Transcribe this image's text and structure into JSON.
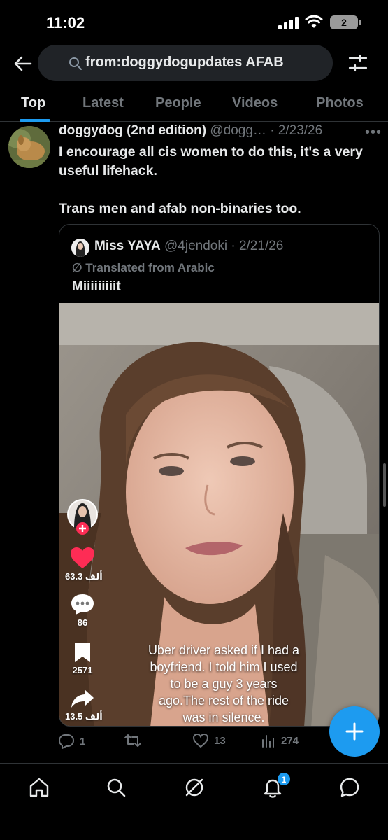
{
  "status_bar": {
    "time": "11:02",
    "battery": "2"
  },
  "search": {
    "query": "from:doggydogupdates AFAB"
  },
  "tabs": [
    {
      "label": "Top"
    },
    {
      "label": "Latest"
    },
    {
      "label": "People"
    },
    {
      "label": "Videos"
    },
    {
      "label": "Photos"
    }
  ],
  "tweet": {
    "author_name": "doggydog (2nd edition)",
    "meta": " @dogg… · 2/23/26",
    "text": "I encourage all cis women to do this, it's a very useful lifehack.\n\nTrans men and afab non-binaries too.",
    "quote": {
      "author_name": "Miss YAYA",
      "meta": " @4jendoki · 2/21/26",
      "translated_label": "Translated from Arabic",
      "text": "Miiiiiiiiit",
      "video": {
        "likes": "63.3 ألف",
        "comments": "86",
        "saves": "2571",
        "shares": "13.5 ألف",
        "caption": "Uber  driver asked if I had a\nboyfriend. I told him I used\nto be a guy 3 years\nago.The rest of the ride\nwas in silence.\nUse it girls"
      }
    },
    "actions": {
      "replies": "1",
      "reposts": "",
      "likes": "13",
      "views": "274"
    }
  },
  "bottom_nav": {
    "notification_count": "1"
  },
  "colors": {
    "accent": "#1d9bf0",
    "background": "#000000",
    "muted": "#71767b",
    "like_red": "#fe2c55"
  }
}
